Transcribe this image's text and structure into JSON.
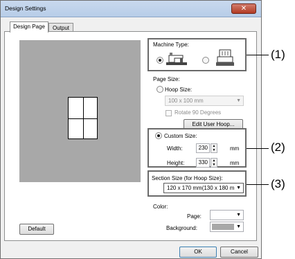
{
  "window": {
    "title": "Design Settings",
    "close_label": "✕"
  },
  "tabs": [
    {
      "label": "Design Page"
    },
    {
      "label": "Output"
    }
  ],
  "machine_type": {
    "label": "Machine Type:",
    "options": [
      "sewing-machine-icon",
      "embroidery-machine-icon"
    ],
    "selected": 0
  },
  "page_size": {
    "label": "Page Size:",
    "hoop": {
      "label": "Hoop Size:",
      "value": "100 x 100 mm",
      "rotate_label": "Rotate 90 Degrees",
      "edit_button": "Edit User Hoop..."
    },
    "custom": {
      "label": "Custom Size:",
      "width_label": "Width:",
      "width_value": "230",
      "height_label": "Height:",
      "height_value": "330",
      "unit": "mm"
    }
  },
  "section_size": {
    "label": "Section Size (for Hoop Size):",
    "value": "120 x 170 mm(130 x 180 m"
  },
  "color": {
    "label": "Color:",
    "page_label": "Page:",
    "background_label": "Background:",
    "page_color": "#ffffff",
    "background_color": "#a8a8a8"
  },
  "buttons": {
    "default": "Default",
    "ok": "OK",
    "cancel": "Cancel"
  },
  "callouts": [
    "(1)",
    "(2)",
    "(3)"
  ]
}
